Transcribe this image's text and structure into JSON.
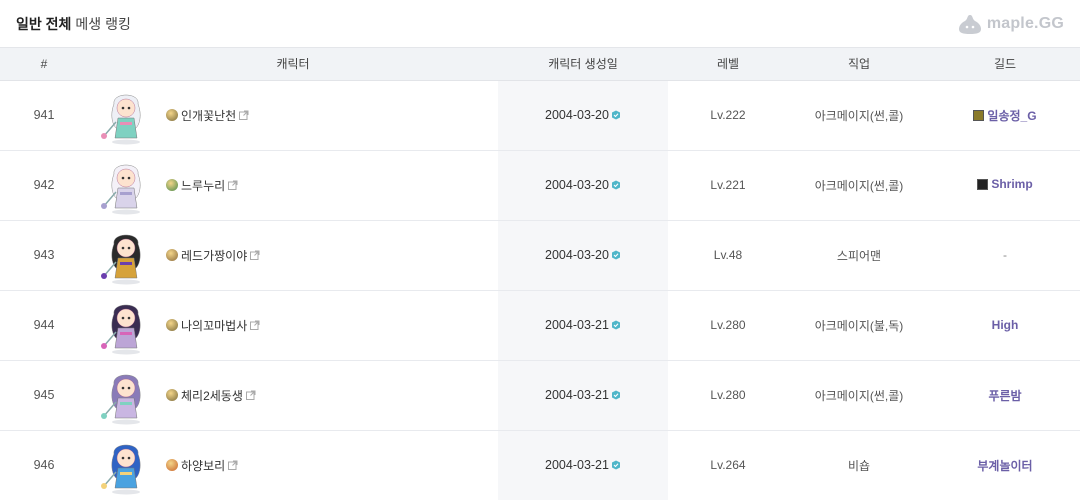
{
  "header": {
    "title_bold": "일반 전체",
    "title_sub": "메생 랭킹",
    "logo_text": "maple.GG"
  },
  "columns": [
    "#",
    "캐릭터",
    "캐릭터 생성일",
    "레벨",
    "직업",
    "길드"
  ],
  "rows": [
    {
      "rank": "941",
      "name": "인개꽃난천",
      "date": "2004-03-20",
      "level": "Lv.222",
      "job": "아크메이지(썬,콜)",
      "guild": "일송정_G",
      "guild_color": "#8a7a2a",
      "avatar": "cleric-white-green",
      "world_color": "#7a6a3a"
    },
    {
      "rank": "942",
      "name": "느루누리",
      "date": "2004-03-20",
      "level": "Lv.221",
      "job": "아크메이지(썬,콜)",
      "guild": "Shrimp",
      "guild_color": "#222222",
      "avatar": "white-hair-mage",
      "world_color": "#4a8a4a"
    },
    {
      "rank": "943",
      "name": "레드가짱이야",
      "date": "2004-03-20",
      "level": "Lv.48",
      "job": "스피어맨",
      "guild": "-",
      "guild_color": "",
      "avatar": "dark-spearman",
      "world_color": "#8a6a3a"
    },
    {
      "rank": "944",
      "name": "나의꼬마법사",
      "date": "2004-03-21",
      "level": "Lv.280",
      "job": "아크메이지(불,독)",
      "guild": "High",
      "guild_color": "",
      "avatar": "purple-hair-mage",
      "world_color": "#7a6a3a"
    },
    {
      "rank": "945",
      "name": "체리2세동생",
      "date": "2004-03-21",
      "level": "Lv.280",
      "job": "아크메이지(썬,콜)",
      "guild": "푸른밤",
      "guild_color": "",
      "avatar": "lavender-mage",
      "world_color": "#7a6a3a"
    },
    {
      "rank": "946",
      "name": "하양보리",
      "date": "2004-03-21",
      "level": "Lv.264",
      "job": "비숍",
      "guild": "부계놀이터",
      "guild_color": "",
      "avatar": "blue-hat-bishop",
      "world_color": "#c8632a"
    }
  ],
  "icons": {
    "external_link": "external-link-icon",
    "verified": "verified-badge-icon",
    "world": "world-icon",
    "logo": "maple-slime-icon"
  },
  "colors": {
    "guild_text": "#6b5fa7",
    "header_bg": "#f1f3f6",
    "date_col_bg": "#f6f7f9",
    "verify": "#4fb6c9"
  }
}
